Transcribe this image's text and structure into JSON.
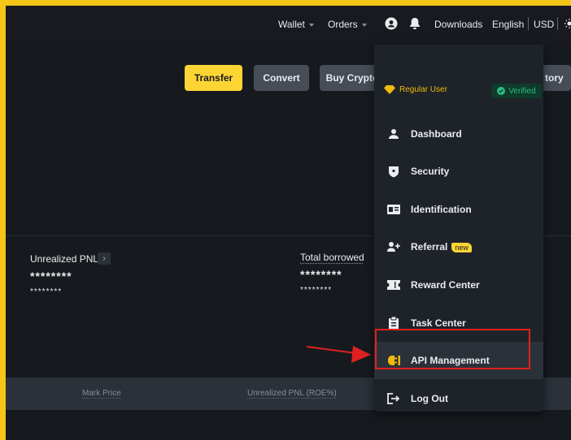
{
  "nav": {
    "wallet": "Wallet",
    "orders": "Orders",
    "downloads": "Downloads",
    "language": "English",
    "currency": "USD"
  },
  "actions": {
    "transfer": "Transfer",
    "convert": "Convert",
    "buy_crypto": "Buy Crypto",
    "history": "tory"
  },
  "overview": {
    "unrealized_label": "Unrealized PNL",
    "unrealized_value": "********",
    "unrealized_sub": "********",
    "borrowed_label": "Total borrowed",
    "borrowed_value": "********",
    "borrowed_sub": "********"
  },
  "table": {
    "headers": [
      "Mark Price",
      "Unrealized PNL (ROE%)"
    ]
  },
  "dropdown": {
    "user_level": "Regular User",
    "verified": "Verified",
    "items": [
      {
        "label": "Dashboard",
        "icon": "person-icon"
      },
      {
        "label": "Security",
        "icon": "shield-icon"
      },
      {
        "label": "Identification",
        "icon": "id-card-icon"
      },
      {
        "label": "Referral",
        "icon": "add-user-icon",
        "badge": "new"
      },
      {
        "label": "Reward Center",
        "icon": "ticket-icon"
      },
      {
        "label": "Task Center",
        "icon": "clipboard-icon"
      },
      {
        "label": "API Management",
        "icon": "api-plug-icon"
      },
      {
        "label": "Log Out",
        "icon": "logout-icon"
      }
    ]
  },
  "colors": {
    "frame": "#f5c518",
    "accent": "#fcd535",
    "verified": "#2ebd85",
    "highlight": "#e02020"
  }
}
